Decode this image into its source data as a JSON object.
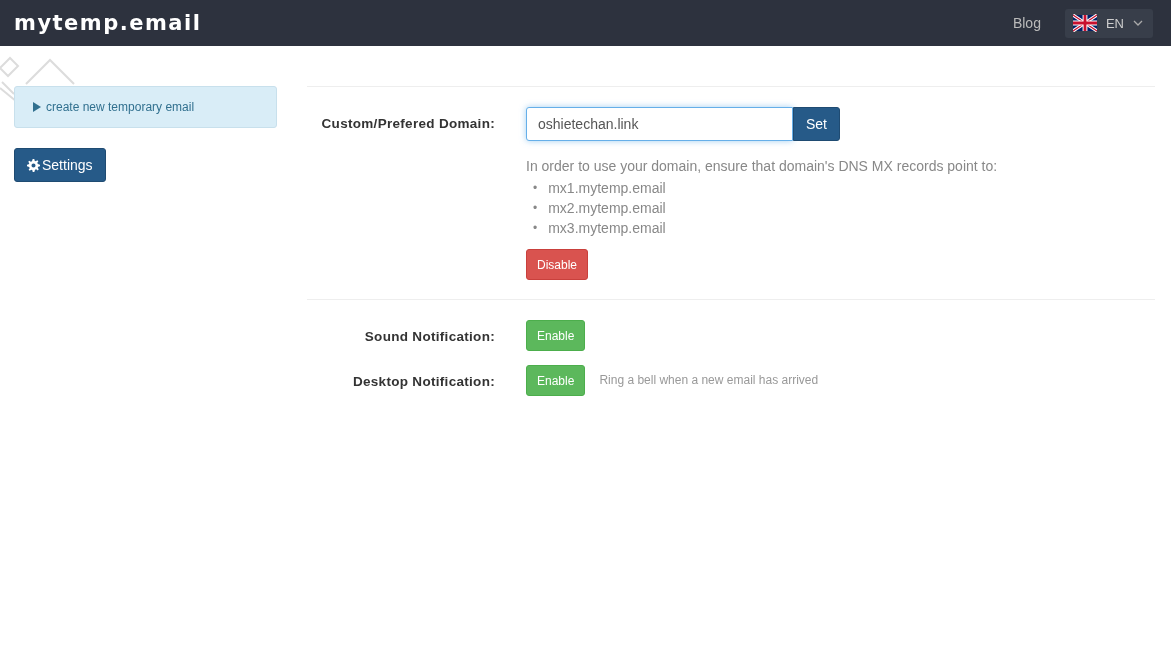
{
  "navbar": {
    "logo": "mytemp.email",
    "links": [
      "Blog"
    ],
    "language": {
      "code": "EN"
    }
  },
  "sidebar": {
    "alert": "create new temporary email",
    "settings_button": "Settings"
  },
  "domain": {
    "label": "Custom/Prefered Domain:",
    "input": {
      "value": "oshietechan.link",
      "focused": true
    },
    "set_button": "Set",
    "help": "In order to use your domain, ensure that domain's DNS MX records point to:",
    "records": [
      {
        "bullet": "•",
        "text": "mx1.mytemp.email"
      },
      {
        "bullet": "•",
        "text": "mx2.mytemp.email"
      },
      {
        "bullet": "•",
        "text": "mx3.mytemp.email"
      }
    ],
    "action": {
      "label": "Disable",
      "kind": "danger"
    }
  },
  "notifications": [
    {
      "label": "Sound Notification:",
      "button": {
        "label": "Enable",
        "kind": "success"
      }
    },
    {
      "label": "Desktop Notification:",
      "button": {
        "label": "Enable",
        "kind": "success"
      },
      "hint": "Ring a bell when a new email has arrived"
    }
  ]
}
